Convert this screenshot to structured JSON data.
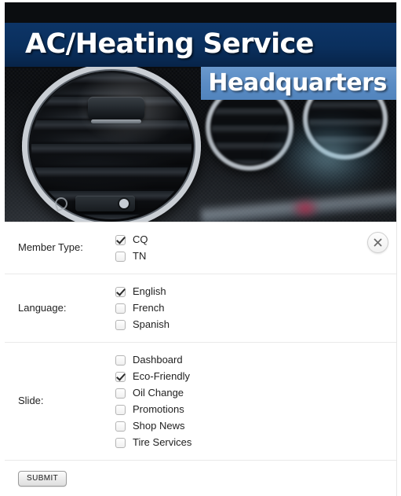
{
  "banner": {
    "title_primary": "AC/Heating Service",
    "title_secondary": "Headquarters",
    "colors": {
      "primary_bar": "#0a2f5d",
      "secondary_bar": "#5b8cc4",
      "title_text": "#ffffff"
    },
    "image_alt": "car-air-vent-photo"
  },
  "dialog": {
    "close_label": "×"
  },
  "form": {
    "sections": [
      {
        "label": "Member Type:",
        "name": "member-type",
        "options": [
          {
            "label": "CQ",
            "checked": true
          },
          {
            "label": "TN",
            "checked": false
          }
        ]
      },
      {
        "label": "Language:",
        "name": "language",
        "options": [
          {
            "label": "English",
            "checked": true
          },
          {
            "label": "French",
            "checked": false
          },
          {
            "label": "Spanish",
            "checked": false
          }
        ]
      },
      {
        "label": "Slide:",
        "name": "slide",
        "options": [
          {
            "label": "Dashboard",
            "checked": false
          },
          {
            "label": "Eco-Friendly",
            "checked": true
          },
          {
            "label": "Oil Change",
            "checked": false
          },
          {
            "label": "Promotions",
            "checked": false
          },
          {
            "label": "Shop News",
            "checked": false
          },
          {
            "label": "Tire Services",
            "checked": false
          }
        ]
      }
    ],
    "submit_label": "SUBMIT"
  }
}
